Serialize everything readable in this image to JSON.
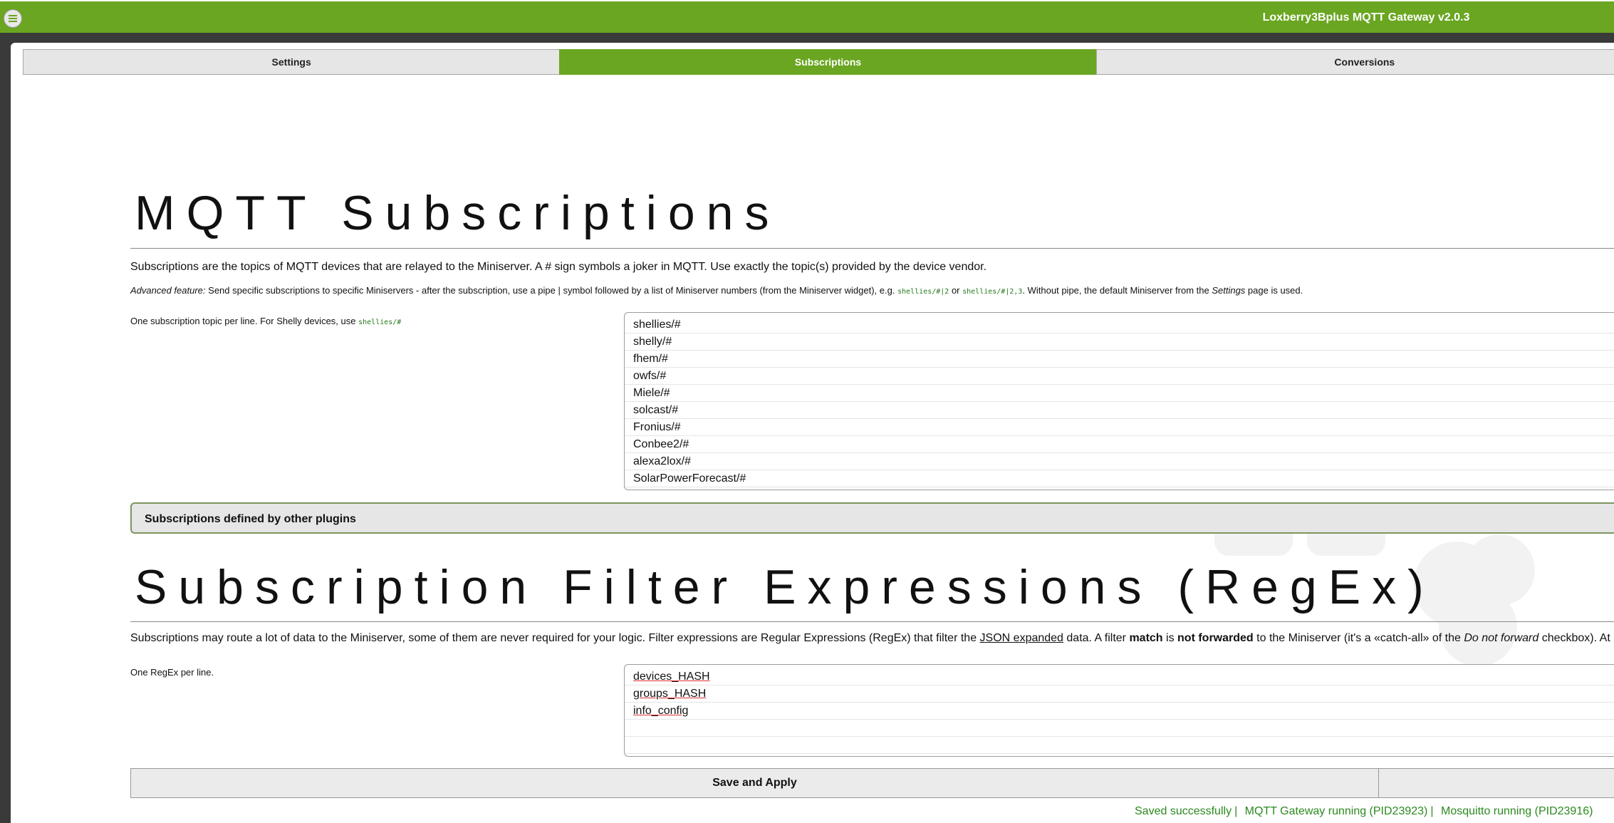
{
  "app": {
    "title": "Loxberry3Bplus MQTT Gateway v2.0.3"
  },
  "tabs": [
    {
      "label": "Settings",
      "active": false
    },
    {
      "label": "Subscriptions",
      "active": true
    },
    {
      "label": "Conversions",
      "active": false
    }
  ],
  "subscriptions": {
    "heading": "MQTT Subscriptions",
    "intro": "Subscriptions are the topics of MQTT devices that are relayed to the Miniserver. A # sign symbols a joker in MQTT. Use exactly the topic(s) provided by the device vendor.",
    "advanced": {
      "label": "Advanced feature:",
      "text1": " Send specific subscriptions to specific Miniservers - after the subscription, use a pipe | symbol followed by a list of Miniserver numbers (from the Miniserver widget), e.g. ",
      "code1": "shellies/#|2",
      "text2": " or ",
      "code2": "shellies/#|2,3",
      "text3": ". Without pipe, the default Miniserver from the ",
      "settings": "Settings",
      "text4": " page is used."
    },
    "field_label": "One subscription topic per line. For Shelly devices, use ",
    "field_code": "shellies/#",
    "topics": [
      "shellies/#",
      "shelly/#",
      "fhem/#",
      "owfs/#",
      "Miele/#",
      "solcast/#",
      "Fronius/#",
      "Conbee2/#",
      "alexa2lox/#",
      "SolarPowerForecast/#"
    ],
    "other_plugins": "Subscriptions defined by other plugins"
  },
  "filters": {
    "heading": "Subscription Filter Expressions (RegEx)",
    "intro1": "Subscriptions may route a lot of data to the Miniserver, some of them are never required for your logic. Filter expressions are Regular Expressions (RegEx) that filter the ",
    "intro_link": "JSON expanded",
    "intro2": " data. A filter ",
    "intro_match": "match",
    "intro3": " is ",
    "intro_notfwd": "not forwarded",
    "intro4": " to the Miniserver (it's a «catch-all» of the ",
    "intro_donot": "Do not forward",
    "intro5": " checkbox). At",
    "field_label": "One RegEx per line.",
    "expressions": [
      "devices_HASH",
      "groups_HASH",
      "info_config",
      "",
      ""
    ]
  },
  "buttons": {
    "save": "Save and Apply",
    "secondary": ""
  },
  "status": {
    "saved": "Saved successfully",
    "gateway": "MQTT Gateway running (PID23923)",
    "mosquitto": "Mosquitto running (PID23916)",
    "sep": "|"
  }
}
